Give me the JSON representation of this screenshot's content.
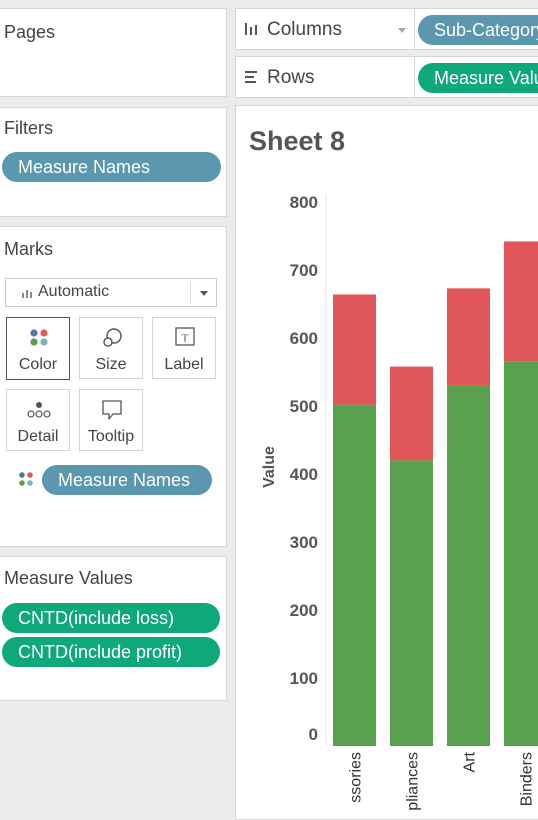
{
  "pages": {
    "title": "Pages"
  },
  "filters": {
    "title": "Filters",
    "pills": [
      "Measure Names"
    ]
  },
  "marks": {
    "title": "Marks",
    "type_selector": "Automatic",
    "buttons": {
      "color": "Color",
      "size": "Size",
      "label": "Label",
      "detail": "Detail",
      "tooltip": "Tooltip"
    },
    "color_field": "Measure Names"
  },
  "measure_values": {
    "title": "Measure Values",
    "pills": [
      "CNTD(include loss)",
      "CNTD(include profit)"
    ]
  },
  "shelves": {
    "columns_label": "Columns",
    "columns_pill": "Sub-Category",
    "rows_label": "Rows",
    "rows_pill": "Measure Values"
  },
  "sheet": {
    "title": "Sheet 8"
  },
  "colors": {
    "profit": "#59a14f",
    "loss": "#e15759",
    "pill_blue": "#5b97ae",
    "pill_green": "#0fa87a"
  },
  "chart_data": {
    "type": "bar",
    "stacked": true,
    "categories": [
      "ssories",
      "pliances",
      "Art",
      "Binders"
    ],
    "series": [
      {
        "name": "CNTD(include profit)",
        "values": [
          502,
          420,
          530,
          565
        ],
        "color": "#59a14f"
      },
      {
        "name": "CNTD(include loss)",
        "values": [
          162,
          138,
          143,
          177
        ],
        "color": "#e15759"
      }
    ],
    "ylabel": "Value",
    "yticks": [
      0,
      100,
      200,
      300,
      400,
      500,
      600,
      700,
      800
    ],
    "ylim": [
      0,
      800
    ]
  }
}
